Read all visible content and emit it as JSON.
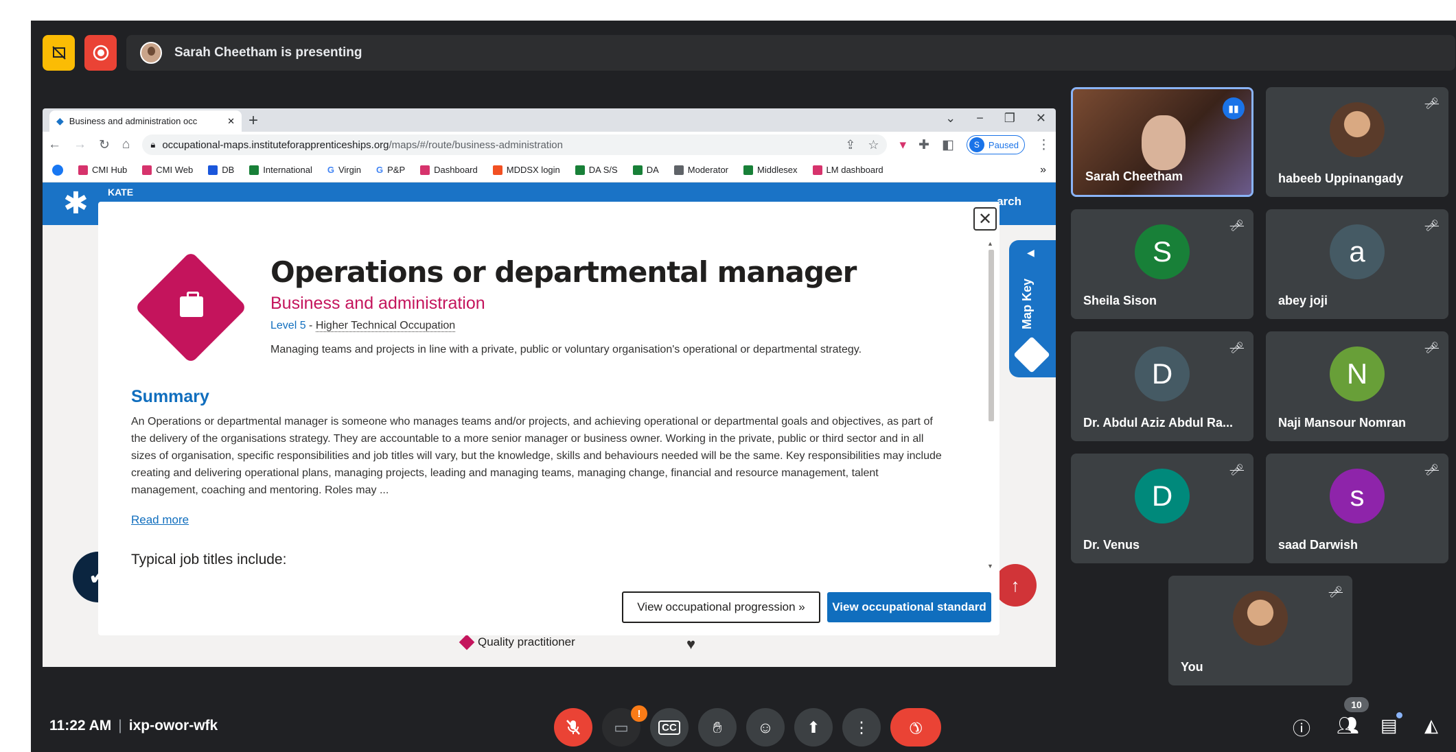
{
  "colors": {
    "meet_bg": "#202124",
    "tile_bg": "#3c4043",
    "accent_blue": "#1a73e8",
    "hangup_red": "#ea4335",
    "route_pink": "#c4145c",
    "kate_blue": "#1a73c6"
  },
  "meet": {
    "presenting_text": "Sarah Cheetham is presenting",
    "top_icons": [
      "present-stop-icon",
      "record-icon"
    ]
  },
  "browser": {
    "tab_title": "Business and administration occ",
    "url_domain": "occupational-maps.instituteforapprenticeships.org",
    "url_path": "/maps/#/route/business-administration",
    "profile_initial": "S",
    "profile_status": "Paused",
    "bookmarks": [
      {
        "label": "CMI Hub",
        "color": "#d6336c"
      },
      {
        "label": "CMI Web",
        "color": "#d6336c"
      },
      {
        "label": "DB",
        "color": "#1a56db"
      },
      {
        "label": "International",
        "color": "#188038"
      },
      {
        "label": "Virgin",
        "color": "#4285f4",
        "glyph": "G"
      },
      {
        "label": "P&P",
        "color": "#4285f4",
        "glyph": "G"
      },
      {
        "label": "Dashboard",
        "color": "#d6336c"
      },
      {
        "label": "MDDSX login",
        "color": "#f25022"
      },
      {
        "label": "DA S/S",
        "color": "#188038"
      },
      {
        "label": "DA",
        "color": "#188038"
      },
      {
        "label": "Moderator",
        "color": "#5f6368"
      },
      {
        "label": "Middlesex",
        "color": "#188038"
      },
      {
        "label": "LM dashboard",
        "color": "#d6336c"
      }
    ],
    "bookmarks_more": "»"
  },
  "page": {
    "kate_logo": "KATE",
    "search_text": "arch",
    "map_key": "Map Key",
    "bg_item": "Quality practitioner"
  },
  "modal": {
    "title": "Operations or departmental manager",
    "route": "Business and administration",
    "level": "Level 5",
    "level_sep": " - ",
    "occupation_type": "Higher Technical Occupation",
    "description": "Managing teams and projects in line with a private, public or voluntary organisation's operational or departmental strategy.",
    "summary_heading": "Summary",
    "summary_text": "An Operations or departmental manager is someone who manages teams and/or projects, and achieving operational or departmental goals and objectives, as part of the delivery of the organisations strategy. They are accountable to a more senior manager or business owner. Working in the private, public or third sector and in all sizes of organisation, specific responsibilities and job titles will vary, but the knowledge, skills and behaviours needed will be the same. Key responsibilities may include creating and delivering operational plans, managing projects, leading and managing teams, managing change, financial and resource management, talent management, coaching and mentoring. Roles may ...",
    "read_more": "Read more",
    "job_titles_heading": "Typical job titles include:",
    "btn_progression": "View occupational progression »",
    "btn_standard": "View occupational standard"
  },
  "participants": [
    {
      "name": "Sarah Cheetham",
      "type": "video",
      "speaking": true
    },
    {
      "name": "habeeb Uppinangady",
      "type": "photo",
      "muted": true
    },
    {
      "name": "Sheila Sison",
      "initial": "S",
      "color": "#188038",
      "muted": true
    },
    {
      "name": "abey joji",
      "initial": "a",
      "color": "#455a64",
      "muted": true
    },
    {
      "name": "Dr. Abdul Aziz Abdul Ra...",
      "initial": "D",
      "color": "#455a64",
      "muted": true
    },
    {
      "name": "Naji Mansour Nomran",
      "initial": "N",
      "color": "#689f38",
      "muted": true
    },
    {
      "name": "Dr. Venus",
      "initial": "D",
      "color": "#00897b",
      "muted": true
    },
    {
      "name": "saad Darwish",
      "initial": "s",
      "color": "#8e24aa",
      "muted": true
    },
    {
      "name": "You",
      "type": "photo",
      "muted": true
    }
  ],
  "bottom": {
    "time": "11:22 AM",
    "meeting_code": "ixp-owor-wfk",
    "camera_warning": "!",
    "people_count": "10"
  }
}
